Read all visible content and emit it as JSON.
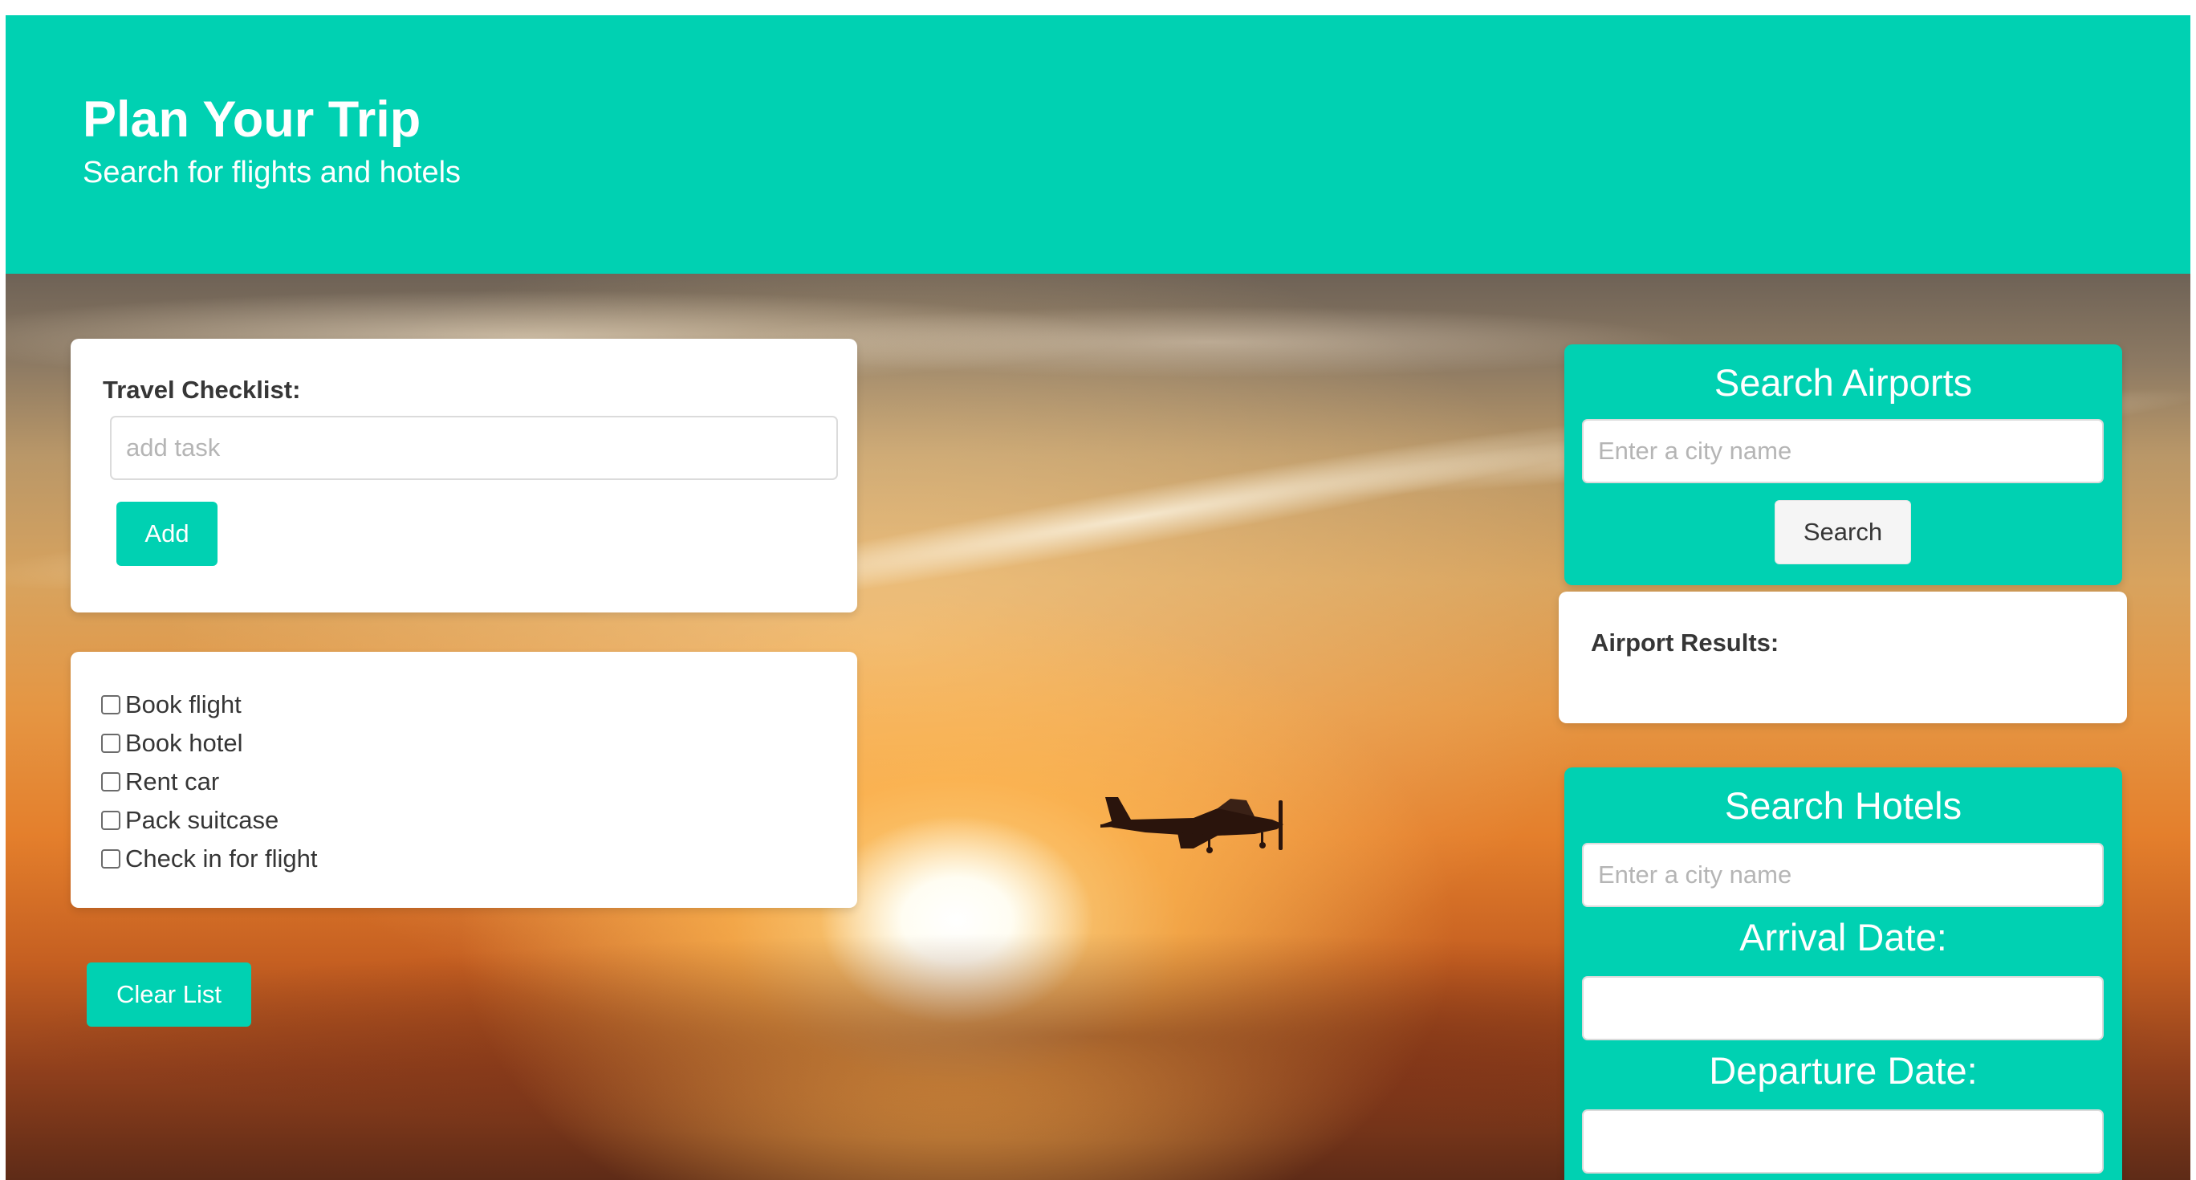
{
  "hero": {
    "title": "Plan Your Trip",
    "subtitle": "Search for flights and hotels",
    "color": "#00d1b2"
  },
  "checklist": {
    "label": "Travel Checklist:",
    "task_placeholder": "add task",
    "add_label": "Add",
    "tasks": [
      {
        "label": "Book flight",
        "checked": false
      },
      {
        "label": "Book hotel",
        "checked": false
      },
      {
        "label": "Rent car",
        "checked": false
      },
      {
        "label": "Pack suitcase",
        "checked": false
      },
      {
        "label": "Check in for flight",
        "checked": false
      }
    ],
    "clear_label": "Clear List"
  },
  "airports": {
    "title": "Search Airports",
    "city_placeholder": "Enter a city name",
    "search_label": "Search",
    "results_label": "Airport Results:"
  },
  "hotels": {
    "title": "Search Hotels",
    "city_placeholder": "Enter a city name",
    "arrival_label": "Arrival Date:",
    "departure_label": "Departure Date:"
  }
}
